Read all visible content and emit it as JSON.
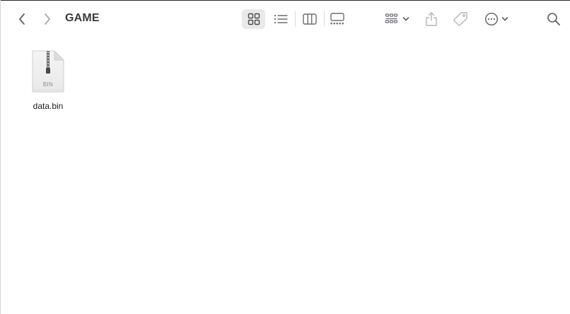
{
  "window": {
    "title": "GAME"
  },
  "toolbar": {
    "back_icon": "chevron-left-icon",
    "forward_icon": "chevron-right-icon",
    "views": [
      {
        "icon": "grid-view-icon",
        "selected": true
      },
      {
        "icon": "list-view-icon",
        "selected": false
      },
      {
        "icon": "column-view-icon",
        "selected": false
      },
      {
        "icon": "gallery-view-icon",
        "selected": false
      }
    ],
    "group_icon": "group-by-icon",
    "share_icon": "share-icon",
    "tag_icon": "tag-icon",
    "more_icon": "ellipsis-circle-icon",
    "search_icon": "search-icon"
  },
  "files": [
    {
      "name": "data.bin",
      "badge": "BIN",
      "icon": "zip-document-icon"
    }
  ],
  "colors": {
    "icon": "#6e6e73",
    "icon_disabled": "#b5b5b8",
    "selected_bg": "#e9e9ea"
  }
}
